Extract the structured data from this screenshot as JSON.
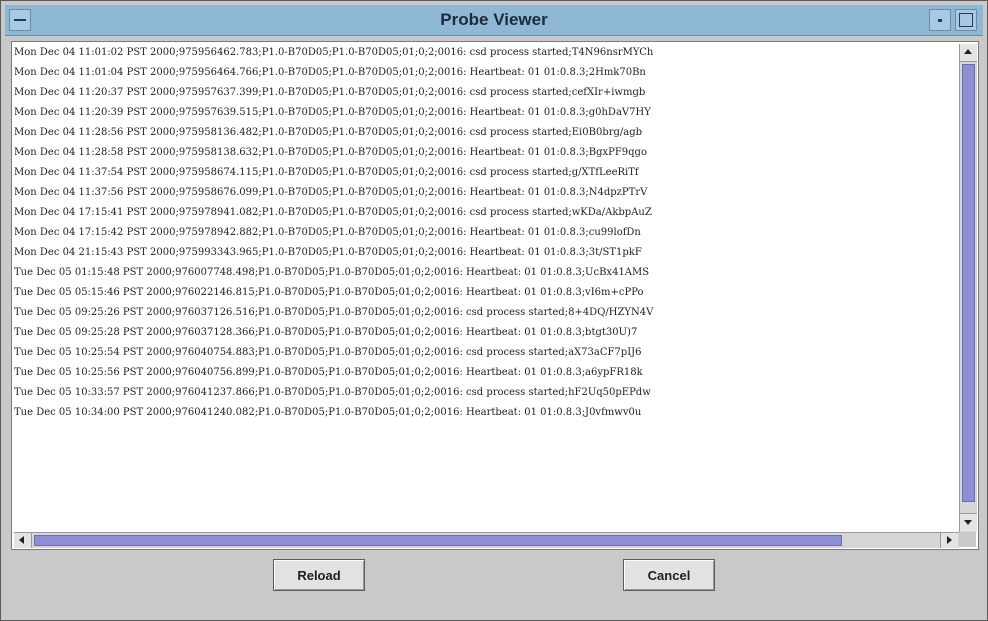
{
  "window": {
    "title": "Probe Viewer"
  },
  "log": {
    "lines": [
      "Mon Dec 04 11:01:02 PST 2000;975956462.783;P1.0-B70D05;P1.0-B70D05;01;0;2;0016: csd process started;T4N96nsrMYCh",
      "Mon Dec 04 11:01:04 PST 2000;975956464.766;P1.0-B70D05;P1.0-B70D05;01;0;2;0016: Heartbeat: 01 01:0.8.3;2Hmk70Bn",
      "Mon Dec 04 11:20:37 PST 2000;975957637.399;P1.0-B70D05;P1.0-B70D05;01;0;2;0016: csd process started;cefXIr+iwmgb",
      "Mon Dec 04 11:20:39 PST 2000;975957639.515;P1.0-B70D05;P1.0-B70D05;01;0;2;0016: Heartbeat: 01 01:0.8.3;g0hDaV7HY",
      "Mon Dec 04 11:28:56 PST 2000;975958136.482;P1.0-B70D05;P1.0-B70D05;01;0;2;0016: csd process started;Ei0B0brg/agb",
      "Mon Dec 04 11:28:58 PST 2000;975958138.632;P1.0-B70D05;P1.0-B70D05;01;0;2;0016: Heartbeat: 01 01:0.8.3;BgxPF9qgo",
      "Mon Dec 04 11:37:54 PST 2000;975958674.115;P1.0-B70D05;P1.0-B70D05;01;0;2;0016: csd process started;g/XTfLeeRiTf",
      "Mon Dec 04 11:37:56 PST 2000;975958676.099;P1.0-B70D05;P1.0-B70D05;01;0;2;0016: Heartbeat: 01 01:0.8.3;N4dpzPTrV",
      "Mon Dec 04 17:15:41 PST 2000;975978941.082;P1.0-B70D05;P1.0-B70D05;01;0;2;0016: csd process started;wKDa/AkbpAuZ",
      "Mon Dec 04 17:15:42 PST 2000;975978942.882;P1.0-B70D05;P1.0-B70D05;01;0;2;0016: Heartbeat: 01 01:0.8.3;cu99lofDn",
      "Mon Dec 04 21:15:43 PST 2000;975993343.965;P1.0-B70D05;P1.0-B70D05;01;0;2;0016: Heartbeat: 01 01:0.8.3;3t/ST1pkF",
      "Tue Dec 05 01:15:48 PST 2000;976007748.498;P1.0-B70D05;P1.0-B70D05;01;0;2;0016: Heartbeat: 01 01:0.8.3;UcBx41AMS",
      "Tue Dec 05 05:15:46 PST 2000;976022146.815;P1.0-B70D05;P1.0-B70D05;01;0;2;0016: Heartbeat: 01 01:0.8.3;vI6m+cPPo",
      "Tue Dec 05 09:25:26 PST 2000;976037126.516;P1.0-B70D05;P1.0-B70D05;01;0;2;0016: csd process started;8+4DQ/HZYN4V",
      "Tue Dec 05 09:25:28 PST 2000;976037128.366;P1.0-B70D05;P1.0-B70D05;01;0;2;0016: Heartbeat: 01 01:0.8.3;btgt30U)7",
      "Tue Dec 05 10:25:54 PST 2000;976040754.883;P1.0-B70D05;P1.0-B70D05;01;0;2;0016: csd process started;aX73aCF7pIJ6",
      "Tue Dec 05 10:25:56 PST 2000;976040756.899;P1.0-B70D05;P1.0-B70D05;01;0;2;0016: Heartbeat: 01 01:0.8.3;a6ypFR18k",
      "Tue Dec 05 10:33:57 PST 2000;976041237.866;P1.0-B70D05;P1.0-B70D05;01;0;2;0016: csd process started;hF2Uq50pEPdw",
      "Tue Dec 05 10:34:00 PST 2000;976041240.082;P1.0-B70D05;P1.0-B70D05;01;0;2;0016: Heartbeat: 01 01:0.8.3;J0vfmwv0u"
    ]
  },
  "buttons": {
    "reload": "Reload",
    "cancel": "Cancel"
  },
  "icons": {
    "window_menu": "window-menu-icon",
    "minimize": "minimize-icon",
    "maximize": "maximize-icon",
    "scroll_up": "arrow-up-icon",
    "scroll_down": "arrow-down-icon",
    "scroll_left": "arrow-left-icon",
    "scroll_right": "arrow-right-icon"
  },
  "colors": {
    "titlebar": "#8fb7d6",
    "scroll_thumb": "#8e8fd2",
    "window_bg": "#c9c9c9"
  }
}
